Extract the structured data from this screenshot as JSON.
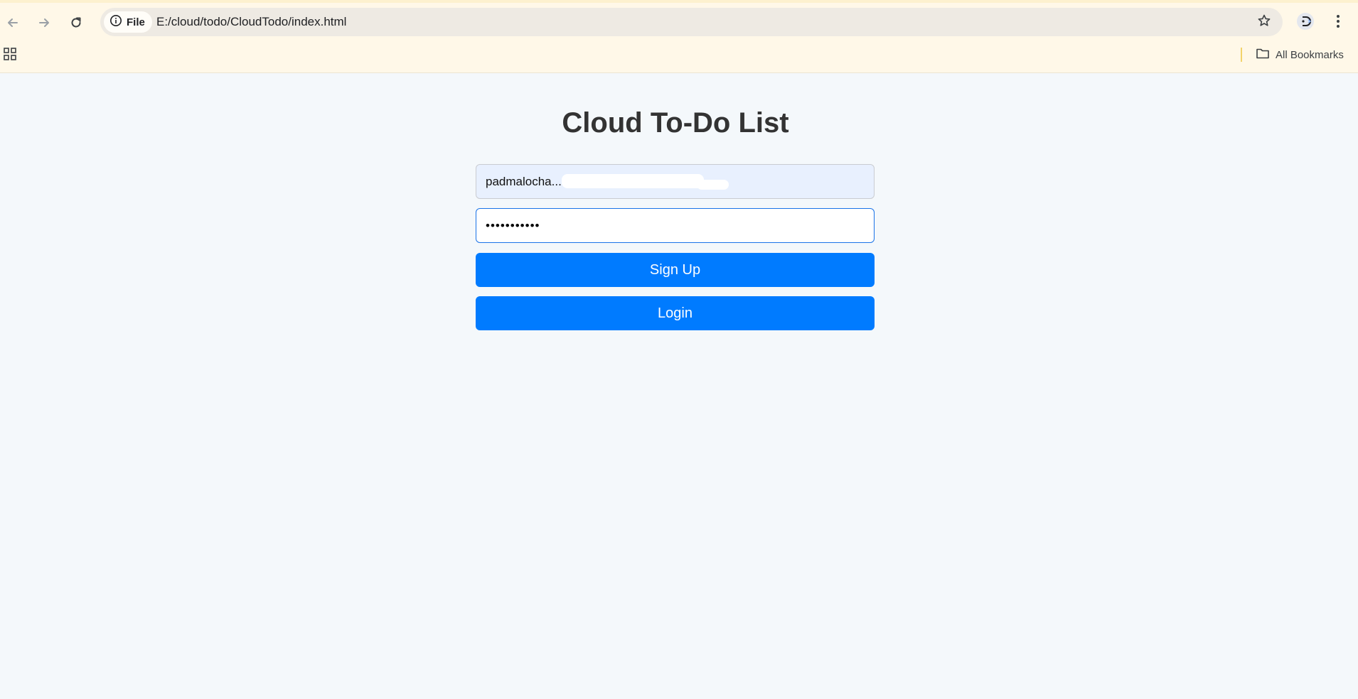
{
  "browser": {
    "site_chip_label": "File",
    "url": "E:/cloud/todo/CloudTodo/index.html",
    "bookmarks_label": "All Bookmarks"
  },
  "page": {
    "title": "Cloud To-Do List",
    "email_value": "padmalocha...@gmail.com",
    "password_value": "•••••••••••",
    "signup_label": "Sign Up",
    "login_label": "Login"
  },
  "colors": {
    "primary_button": "#007bff",
    "page_background": "#f4f8fb",
    "title_text": "#333333"
  },
  "icons": [
    "back-arrow-icon",
    "forward-arrow-icon",
    "reload-icon",
    "info-icon",
    "star-icon",
    "profile-icon",
    "kebab-menu-icon",
    "apps-grid-icon",
    "folder-icon"
  ]
}
